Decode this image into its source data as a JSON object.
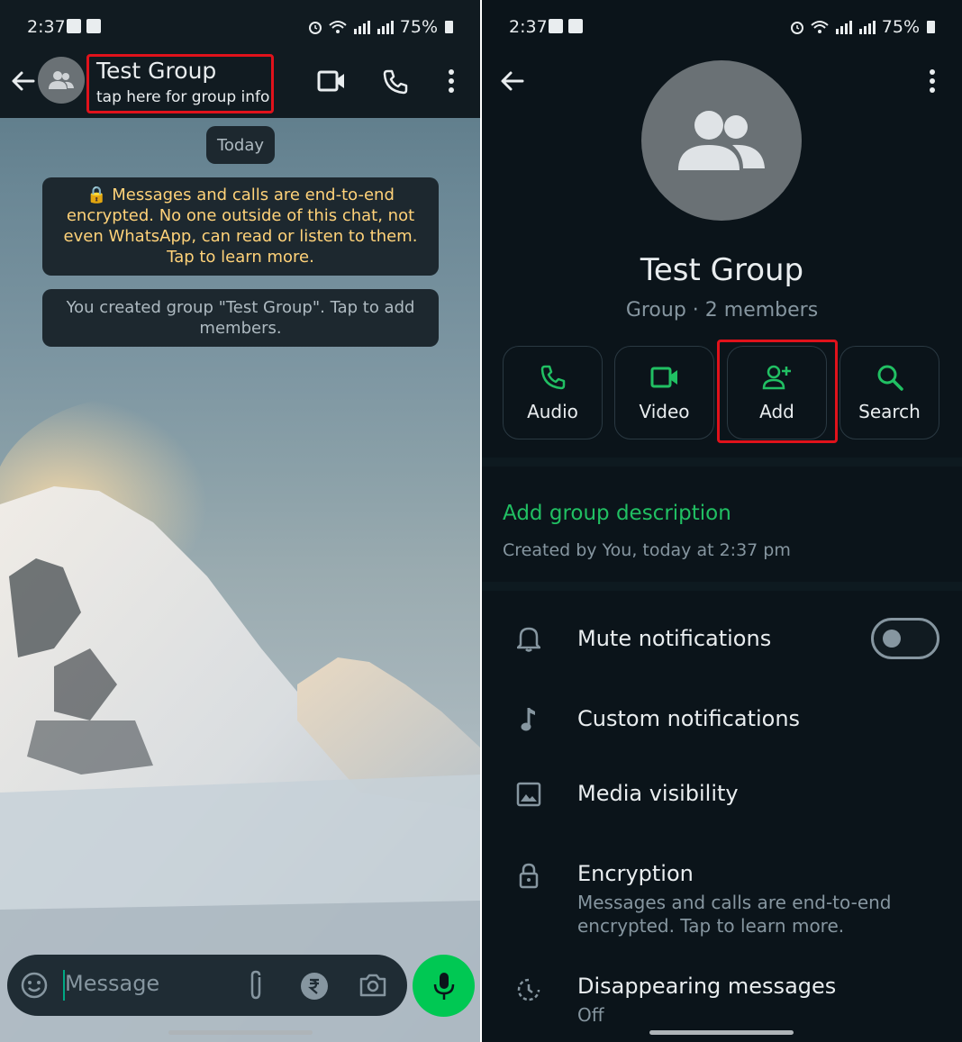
{
  "status_bar": {
    "time": "2:37",
    "battery": "75%"
  },
  "chat_screen": {
    "header": {
      "title": "Test Group",
      "subtitle": "tap here for group info"
    },
    "date_pill": "Today",
    "encryption_notice": "🔒 Messages and calls are end-to-end encrypted. No one outside of this chat, not even WhatsApp, can read or listen to them. Tap to learn more.",
    "created_notice": "You created group \"Test Group\". Tap to add members.",
    "composer": {
      "placeholder": "Message"
    },
    "colors": {
      "header_bg": "#111b21",
      "mic_button": "#00c853",
      "encryption_text": "#ffd279"
    }
  },
  "group_info": {
    "name": "Test Group",
    "meta": "Group · 2 members",
    "actions": [
      {
        "label": "Audio",
        "icon": "phone-icon"
      },
      {
        "label": "Video",
        "icon": "video-icon"
      },
      {
        "label": "Add",
        "icon": "add-person-icon"
      },
      {
        "label": "Search",
        "icon": "search-icon"
      }
    ],
    "add_description": "Add group description",
    "created_by": "Created by You, today at 2:37 pm",
    "settings": {
      "mute": {
        "title": "Mute notifications",
        "enabled": false
      },
      "custom": {
        "title": "Custom notifications"
      },
      "media": {
        "title": "Media visibility"
      },
      "encryption": {
        "title": "Encryption",
        "subtitle": "Messages and calls are end-to-end encrypted. Tap to learn more."
      },
      "disappearing": {
        "title": "Disappearing messages",
        "subtitle": "Off"
      }
    },
    "colors": {
      "background": "#0b141a",
      "accent_green": "#21c063",
      "highlight_box": "#e0121b"
    }
  }
}
